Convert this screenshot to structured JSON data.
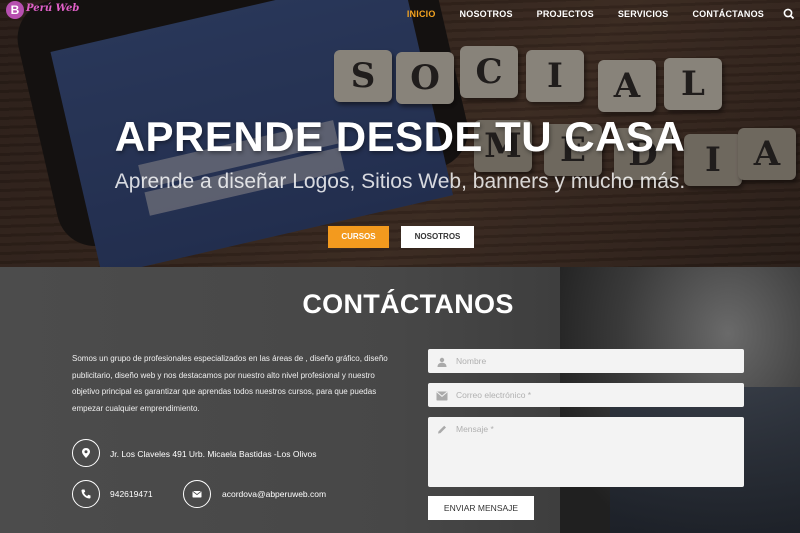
{
  "header": {
    "logo_text": "Perú Web",
    "nav": [
      {
        "label": "INICIO",
        "active": true
      },
      {
        "label": "NOSOTROS",
        "active": false
      },
      {
        "label": "PROJECTOS",
        "active": false
      },
      {
        "label": "SERVICIOS",
        "active": false
      },
      {
        "label": "CONTÁCTANOS",
        "active": false
      }
    ],
    "search_icon": "search-icon"
  },
  "hero": {
    "title": "APRENDE DESDE TU CASA",
    "subtitle": "Aprende a diseñar Logos, Sitios Web, banners y mucho más.",
    "btn_primary": "CURSOS",
    "btn_secondary": "NOSOTROS",
    "tiles": [
      "S",
      "O",
      "C",
      "I",
      "A",
      "L",
      "M",
      "E",
      "D",
      "I",
      "A"
    ]
  },
  "contact": {
    "title": "CONTÁCTANOS",
    "about": "Somos un grupo de profesionales especializados en las áreas de , diseño gráfico, diseño publicitario, diseño web y nos destacamos por nuestro alto nivel profesional y nuestro objetivo principal es garantizar que aprendas todos nuestros cursos, para que puedas empezar cualquier emprendimiento.",
    "address": "Jr. Los Claveles 491 Urb. Micaela Bastidas -Los Olivos",
    "phone": "942619471",
    "email": "acordova@abperuweb.com",
    "form": {
      "name_placeholder": "Nombre",
      "email_placeholder": "Correo electrónico *",
      "message_placeholder": "Mensaje *",
      "submit": "ENVIAR MENSAJE"
    }
  },
  "colors": {
    "accent": "#f39a1e",
    "logo": "#e160c8",
    "contact_bg": "#474747"
  }
}
